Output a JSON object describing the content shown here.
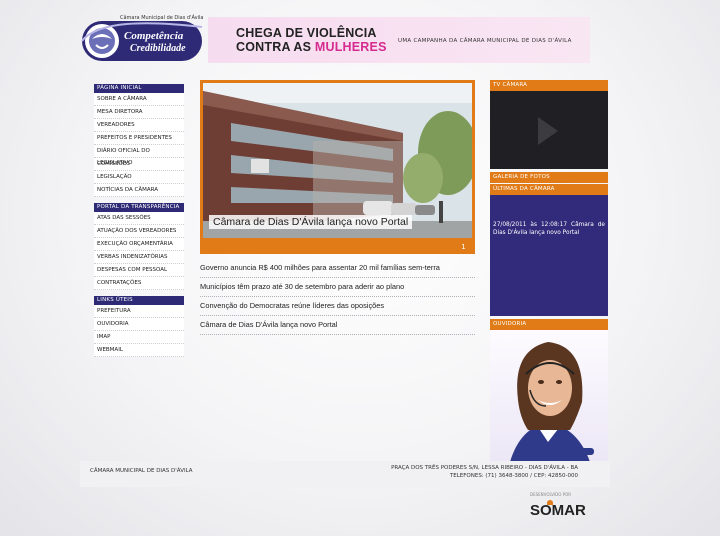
{
  "header": {
    "logo_top": "Câmara Municipal de Dias d'Ávila",
    "logo_line1": "Competência",
    "logo_line2": "Credibilidade",
    "banner_line1": "CHEGA DE VIOLÊNCIA",
    "banner_line2_a": "CONTRA AS ",
    "banner_line2_b": "MULHERES",
    "banner_sub": "UMA CAMPANHA DA CÂMARA MUNICIPAL DE DIAS D'ÁVILA"
  },
  "nav": {
    "group1": {
      "head": "PÁGINA INICIAL",
      "items": [
        "SOBRE A CÂMARA",
        "MESA DIRETORA",
        "VEREADORES",
        "PREFEITOS E PRESIDENTES",
        "DIÁRIO OFICIAL DO LEGISLATIVO",
        "COMISSÕES",
        "LEGISLAÇÃO",
        "NOTÍCIAS DA CÂMARA"
      ]
    },
    "group2": {
      "head": "PORTAL DA TRANSPARÊNCIA",
      "items": [
        "ATAS DAS SESSÕES",
        "ATUAÇÃO DOS VEREADORES",
        "EXECUÇÃO ORÇAMENTÁRIA",
        "VERBAS INDENIZATÓRIAS",
        "DESPESAS COM PESSOAL",
        "CONTRATAÇÕES"
      ]
    },
    "group3": {
      "head": "LINKS ÚTEIS",
      "items": [
        "PREFEITURA",
        "OUVIDORIA",
        "IMAP",
        "WEBMAIL"
      ]
    }
  },
  "hero": {
    "caption": "Câmara de Dias D'Ávila lança novo Portal",
    "page": "1"
  },
  "news": [
    "Governo anuncia R$ 400 milhões para assentar 20 mil famílias sem-terra",
    "Municípios têm prazo até 30 de setembro para aderir ao plano",
    "Convenção do Democratas reúne líderes das oposições",
    "Câmara de Dias D'Ávila lança novo Portal"
  ],
  "right": {
    "tv_head": "TV CÂMARA",
    "galeria": "GALERIA DE FOTOS",
    "ultimas": "ÚLTIMAS DA CÂMARA",
    "ultimas_text": "27/08/2011 às 12:08:17 Câmara de Dias D'Ávila lança novo Portal",
    "ouvidoria": "OUVIDORIA"
  },
  "footer": {
    "left": "CÂMARA MUNICIPAL DE DIAS D'ÁVILA",
    "addr1": "PRAÇA DOS TRÊS PODERES S/N, LESSA RIBEIRO - DIAS D'ÁVILA - BA",
    "addr2": "TELEFONES: (71) 3648-3800 / CEP: 42850-000",
    "credit": "DESENVOLVIDO POR",
    "brand": "SOMAR"
  },
  "colors": {
    "navy": "#2e2a76",
    "orange": "#e07b17",
    "pink": "#d62b8f"
  }
}
